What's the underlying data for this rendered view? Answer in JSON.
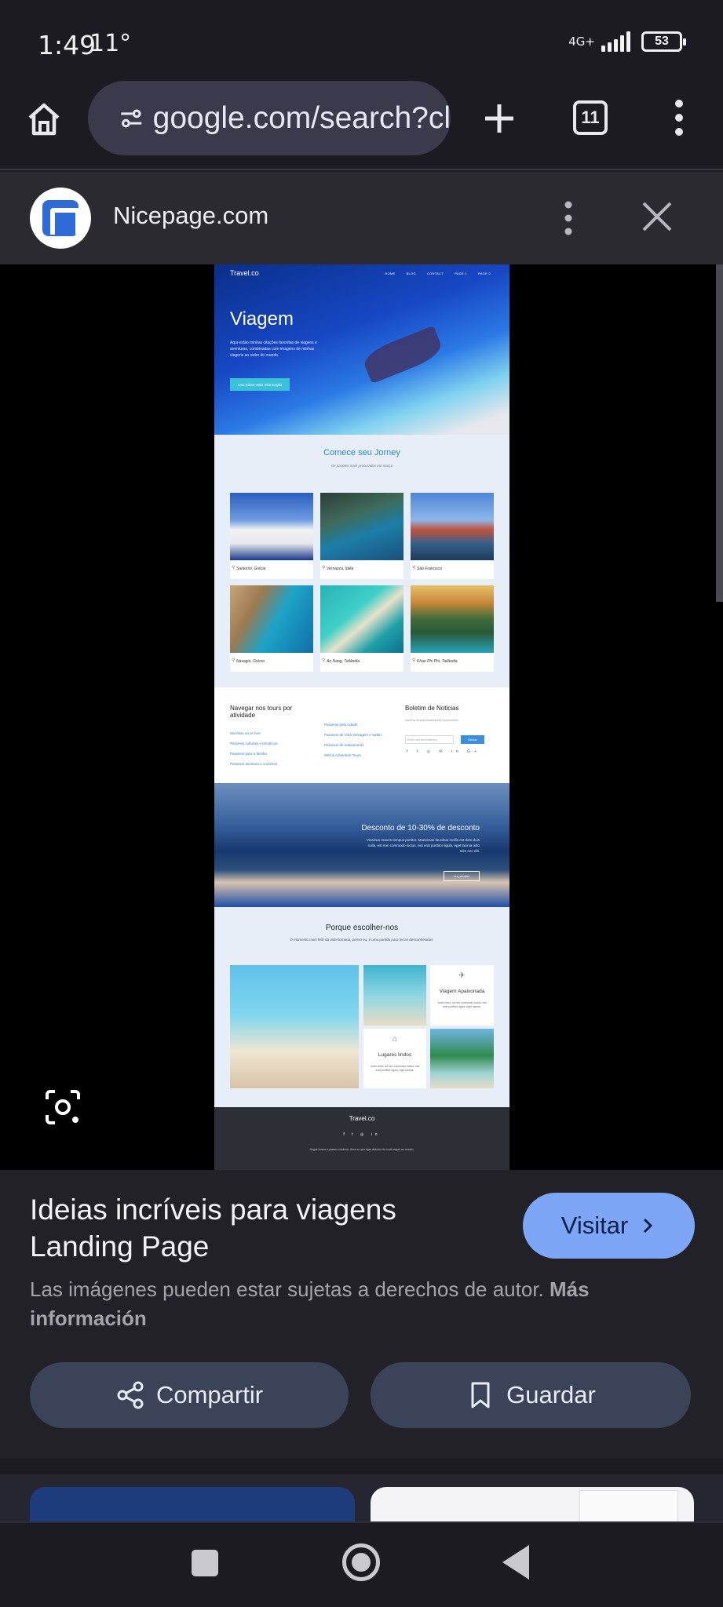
{
  "status": {
    "time": "1:49",
    "temp": "11°",
    "network": "4G+",
    "battery": "53"
  },
  "browser": {
    "url": "google.com/search?cl",
    "tab_count": "11"
  },
  "sheet": {
    "site_name": "Nicepage.com"
  },
  "preview": {
    "brand": "Travel.co",
    "nav": [
      "HOME",
      "BLOG",
      "CONTACT",
      "PAGE 1",
      "PAGE 2"
    ],
    "hero_title": "Viagem",
    "hero_desc": "Aqui estão minhas citações favoritas de viagens e aventuras, combinadas com imagens de minhas viagens ao redor do mundo.",
    "hero_button": "Leia Sobre Mais Informação",
    "section_title": "Comece seu Jorney",
    "section_sub": "Os pacotes mais procurados em março",
    "cards": [
      {
        "caption": "Santorini, Grécia"
      },
      {
        "caption": "Vernazza, Itália"
      },
      {
        "caption": "São Francisco"
      },
      {
        "caption": "Navagio, Grécia"
      },
      {
        "caption": "Ao Nang, Tailândia"
      },
      {
        "caption": "Khao Phi Phi, Tailândia"
      }
    ],
    "tours_heading": "Navegar nos tours por atividade",
    "tours_col1": [
      "Mochilas ao ar livre",
      "Passeios culturais e temáticos",
      "Passeios para a família",
      "Passeios aventura e cruzeiros"
    ],
    "tours_col2": [
      "Passeios pela cidade",
      "Passeios de Vida Selvagem e Safari",
      "Passeios de relaxamento",
      "Wild & Adventure Tours"
    ],
    "newsletter_heading": "Boletim de Noticias",
    "newsletter_sub": "Inscreva-se para atualizações e promoções",
    "newsletter_placeholder": "Entre com seu endereço",
    "newsletter_button": "Enviar",
    "newsletter_social": "f t ◎ ✉ in G+",
    "discount_title": "Desconto de 10-30% de desconto",
    "discount_text": "Vivamus mauris tempus portitor. Maecenas faucibus mollis est dom-duis nulla, est non commodo luctus, nisi erat porttitor ligula, eget lacinia odio sem nec elit.",
    "discount_button": "ver pacotes",
    "why_title": "Porque escolher-nos",
    "why_sub": "O momento mais feliz da vida humana, penso eu, é uma partida para terras desconhecidas.",
    "why_box1_title": "Viagem Apaixonada",
    "why_box1_text": "Justo dolor, sit nec commodo luctus, nisi erat porttitor ligula, eget lacinia.",
    "why_box2_title": "Lugares lindos",
    "why_box2_text": "Justo dolor, sit nec commodo luctus, nisi erat porttitor ligula, eget lacinia.",
    "footer_brand": "Travel.co",
    "footer_social": "f t ◎ in",
    "footer_text": "Seguir busca a passos mínimos. Itens so que ligar dinheiro do você seguir ao mundo."
  },
  "info": {
    "title": "Ideias incríveis para viagens Landing Page",
    "visit_label": "Visitar",
    "copyright_text": "Las imágenes pueden estar sujetas a derechos de autor.",
    "more_info": "Más información",
    "share_label": "Compartir",
    "save_label": "Guardar"
  },
  "colors": {
    "accent": "#7ea6f7",
    "surface": "#212127",
    "button": "#3a4358"
  },
  "icons": {
    "home": "home-icon",
    "tune": "tune-icon",
    "plus": "plus-icon",
    "tabs": "tabs-icon",
    "menu": "kebab-menu-icon",
    "close": "close-icon",
    "lens": "lens-icon",
    "share": "share-icon",
    "bookmark": "bookmark-icon"
  }
}
